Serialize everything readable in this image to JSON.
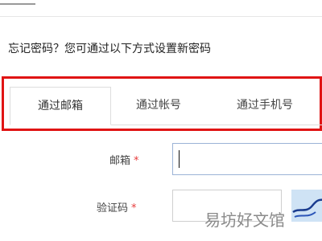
{
  "intro": "忘记密码？您可通过以下方式设置新密码",
  "tabs": [
    {
      "label": "通过邮箱",
      "active": true
    },
    {
      "label": "通过帐号",
      "active": false
    },
    {
      "label": "通过手机号",
      "active": false
    }
  ],
  "form": {
    "email_label": "邮箱",
    "code_label": "验证码",
    "required_mark": "*",
    "email_value": "",
    "code_value": ""
  },
  "watermark": "易坊好文馆",
  "colors": {
    "highlight": "#e01414",
    "required": "#e63b3b",
    "input_focus_border": "#9bb3d6",
    "captcha_bg": "#cfe3f5"
  }
}
